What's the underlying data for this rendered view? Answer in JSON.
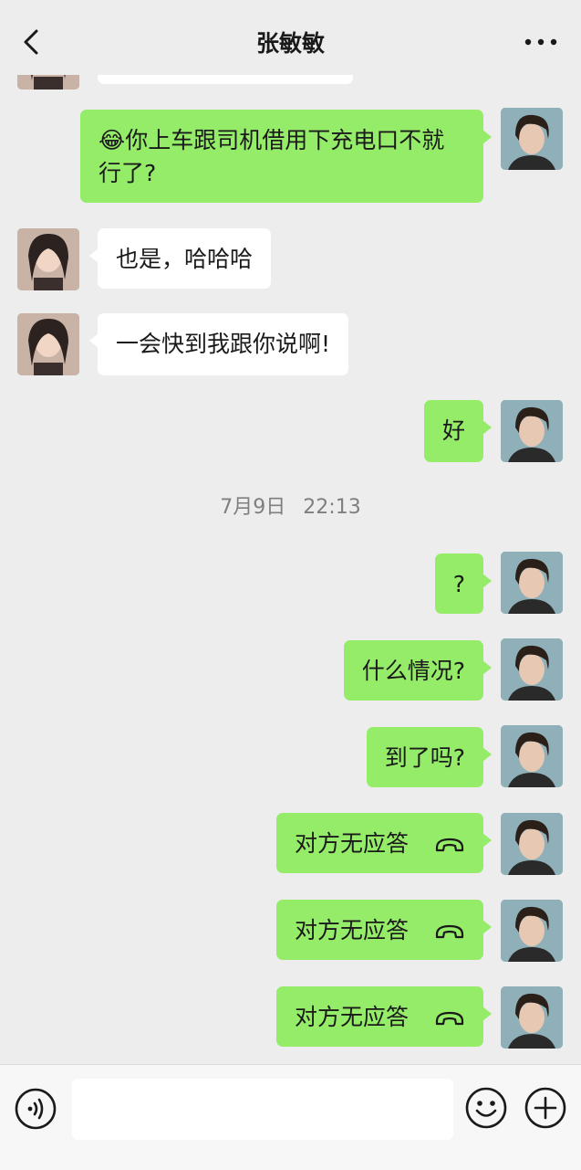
{
  "header": {
    "title": "张敏敏",
    "back_icon": "chevron-left-icon",
    "more_icon": "more-dots-icon"
  },
  "messages": [
    {
      "dir": "in",
      "text": "",
      "partial": true
    },
    {
      "dir": "out",
      "emoji": "😂",
      "text": "你上车跟司机借用下充电口不就行了?"
    },
    {
      "dir": "in",
      "text": "也是，哈哈哈"
    },
    {
      "dir": "in",
      "text": "一会快到我跟你说啊!"
    },
    {
      "dir": "out",
      "text": "好"
    },
    {
      "dir": "out",
      "text": "?"
    },
    {
      "dir": "out",
      "text": "什么情况?"
    },
    {
      "dir": "out",
      "text": "到了吗?"
    },
    {
      "dir": "out",
      "text": "对方无应答",
      "call": true,
      "icon": "phone-hangup-icon"
    },
    {
      "dir": "out",
      "text": "对方无应答",
      "call": true,
      "icon": "phone-hangup-icon"
    },
    {
      "dir": "out",
      "text": "对方无应答",
      "call": true,
      "icon": "phone-hangup-icon"
    }
  ],
  "timestamp": {
    "date": "7月9日",
    "time": "22:13"
  },
  "input_bar": {
    "voice_icon": "voice-icon",
    "input_value": "",
    "emoji_icon": "emoji-icon",
    "plus_icon": "plus-icon"
  },
  "colors": {
    "background": "#ededed",
    "outgoing_bubble": "#95ec69",
    "incoming_bubble": "#ffffff",
    "timestamp_text": "#7f7f7f"
  }
}
